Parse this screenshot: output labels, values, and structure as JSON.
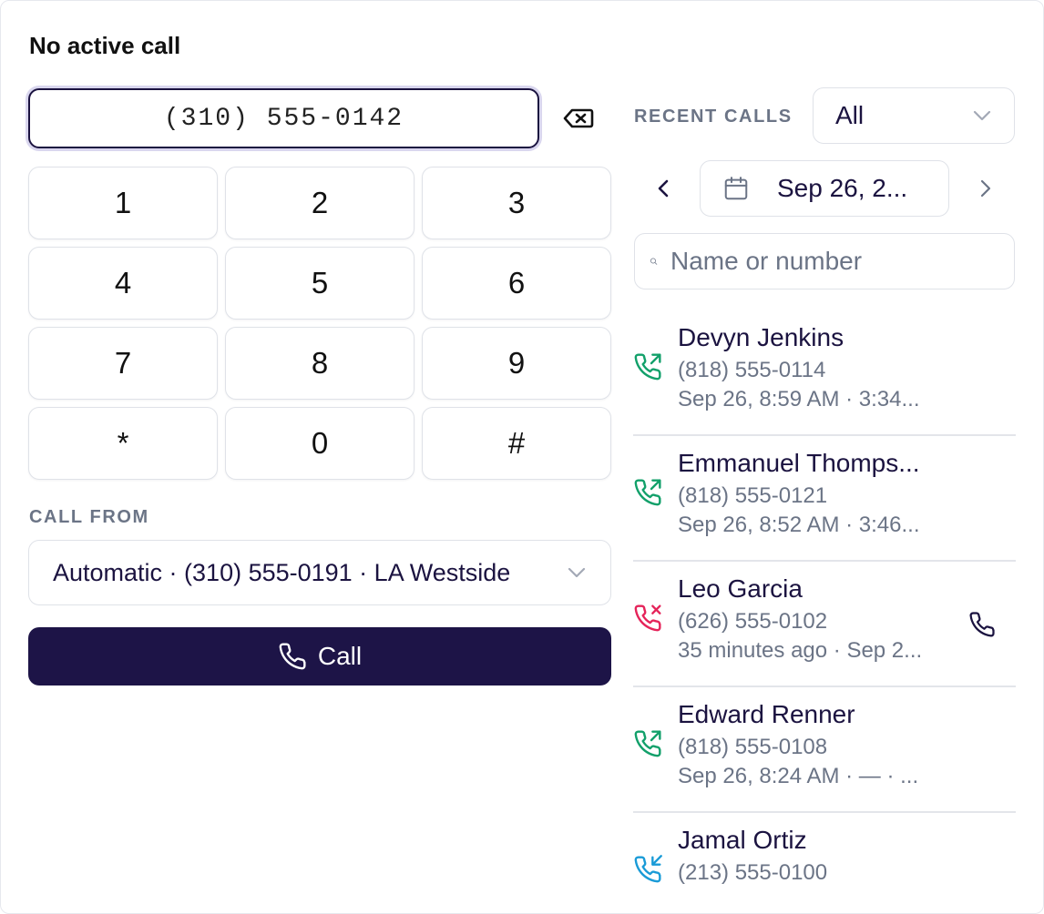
{
  "status": {
    "title": "No active call"
  },
  "dialer": {
    "number": "(310) 555-0142",
    "keys": [
      "1",
      "2",
      "3",
      "4",
      "5",
      "6",
      "7",
      "8",
      "9",
      "*",
      "0",
      "#"
    ]
  },
  "call_from": {
    "label": "CALL FROM",
    "selected": "Automatic · (310) 555-0191 · LA Westside"
  },
  "call_button": {
    "label": "Call"
  },
  "recent": {
    "label": "RECENT CALLS",
    "filter": "All",
    "date": "Sep 26, 2...",
    "search_placeholder": "Name or number",
    "calls": [
      {
        "name": "Devyn Jenkins",
        "number": "(818) 555-0114",
        "meta": "Sep 26, 8:59 AM · 3:34...",
        "direction": "outgoing"
      },
      {
        "name": "Emmanuel Thomps...",
        "number": "(818) 555-0121",
        "meta": "Sep 26, 8:52 AM · 3:46...",
        "direction": "outgoing"
      },
      {
        "name": "Leo Garcia",
        "number": "(626) 555-0102",
        "meta": "35 minutes ago · Sep 2...",
        "direction": "missed"
      },
      {
        "name": "Edward Renner",
        "number": "(818) 555-0108",
        "meta": "Sep 26, 8:24 AM · — · ...",
        "direction": "outgoing"
      },
      {
        "name": "Jamal Ortiz",
        "number": "(213) 555-0100",
        "meta": "",
        "direction": "incoming"
      }
    ]
  },
  "colors": {
    "primary": "#1d1447",
    "outgoing": "#12a06a",
    "missed": "#e5245a",
    "incoming": "#1a9bd7",
    "muted": "#6b7486"
  },
  "icons": {
    "backspace": "backspace-icon",
    "phone": "phone-icon",
    "calendar": "calendar-icon",
    "search": "search-icon",
    "chevron_down": "chevron-down-icon",
    "chevron_left": "chevron-left-icon",
    "chevron_right": "chevron-right-icon"
  }
}
